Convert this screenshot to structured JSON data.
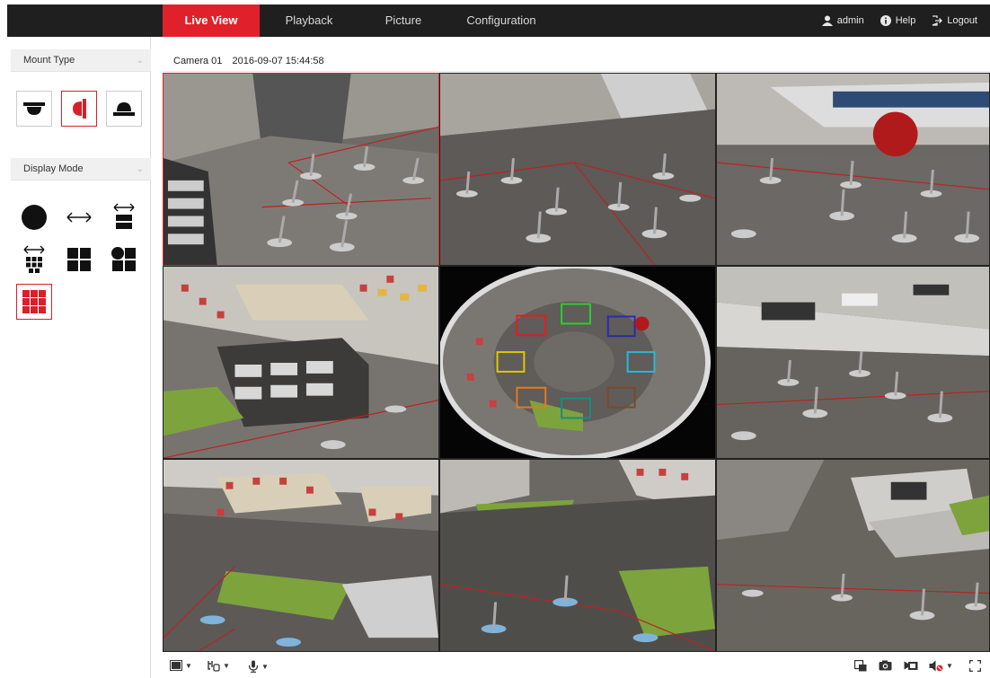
{
  "nav": {
    "tabs": [
      {
        "label": "Live View",
        "active": true
      },
      {
        "label": "Playback",
        "active": false
      },
      {
        "label": "Picture",
        "active": false
      },
      {
        "label": "Configuration",
        "active": false
      }
    ],
    "user": "admin",
    "help": "Help",
    "logout": "Logout"
  },
  "left": {
    "mount_type_label": "Mount Type",
    "display_mode_label": "Display Mode",
    "mount_icons": [
      "ceiling-mount-icon",
      "wall-mount-icon",
      "desktop-mount-icon"
    ],
    "display_icons": [
      "fisheye-icon",
      "panorama-icon",
      "dual-panorama-icon",
      "panorama-3ptz-icon",
      "quad-ptz-icon",
      "fisheye-3ptz-icon",
      "fisheye-8ptz-icon"
    ],
    "selected_mount": "wall-mount-icon",
    "selected_display": "fisheye-8ptz-icon"
  },
  "camera": {
    "name": "Camera 01",
    "timestamp": "2016-09-07 15:44:58"
  },
  "colors": {
    "accent": "#e0212b",
    "topbar": "#1f1f1f"
  },
  "toolbar": {
    "left_icons": [
      "window-layout-icon",
      "stream-type-icon",
      "microphone-icon"
    ],
    "right_icons": [
      "pip-icon",
      "capture-icon",
      "record-icon",
      "audio-icon",
      "fullscreen-icon"
    ]
  }
}
